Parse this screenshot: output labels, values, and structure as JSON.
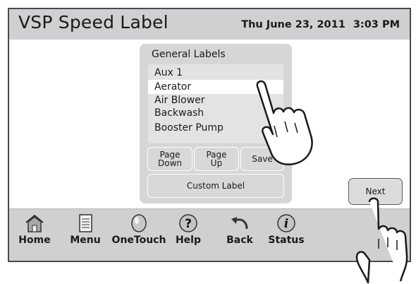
{
  "header": {
    "title": "VSP Speed Label",
    "date": "Thu June 23, 2011",
    "time": "3:03 PM"
  },
  "labels_panel": {
    "title": "General Labels",
    "items": [
      "Aux 1",
      "Aerator",
      "Air Blower",
      "Backwash",
      "Booster Pump"
    ],
    "selected_item": "Aerator",
    "page_down_line1": "Page",
    "page_down_line2": "Down",
    "page_up_line1": "Page",
    "page_up_line2": "Up",
    "save_label": "Save",
    "custom_label": "Custom Label"
  },
  "next_label": "Next",
  "nav": {
    "items": [
      {
        "label": "Home",
        "icon": "home-icon"
      },
      {
        "label": "Menu",
        "icon": "menu-icon"
      },
      {
        "label": "OneTouch",
        "icon": "onetouch-icon"
      },
      {
        "label": "Help",
        "icon": "help-icon"
      },
      {
        "label": "Back",
        "icon": "back-icon"
      },
      {
        "label": "Status",
        "icon": "status-icon"
      }
    ]
  },
  "colors": {
    "bar": "#d0d0d2",
    "panel": "#d6d6d8",
    "selected_row": "#ffffff",
    "frame": "#4a4a4a"
  }
}
